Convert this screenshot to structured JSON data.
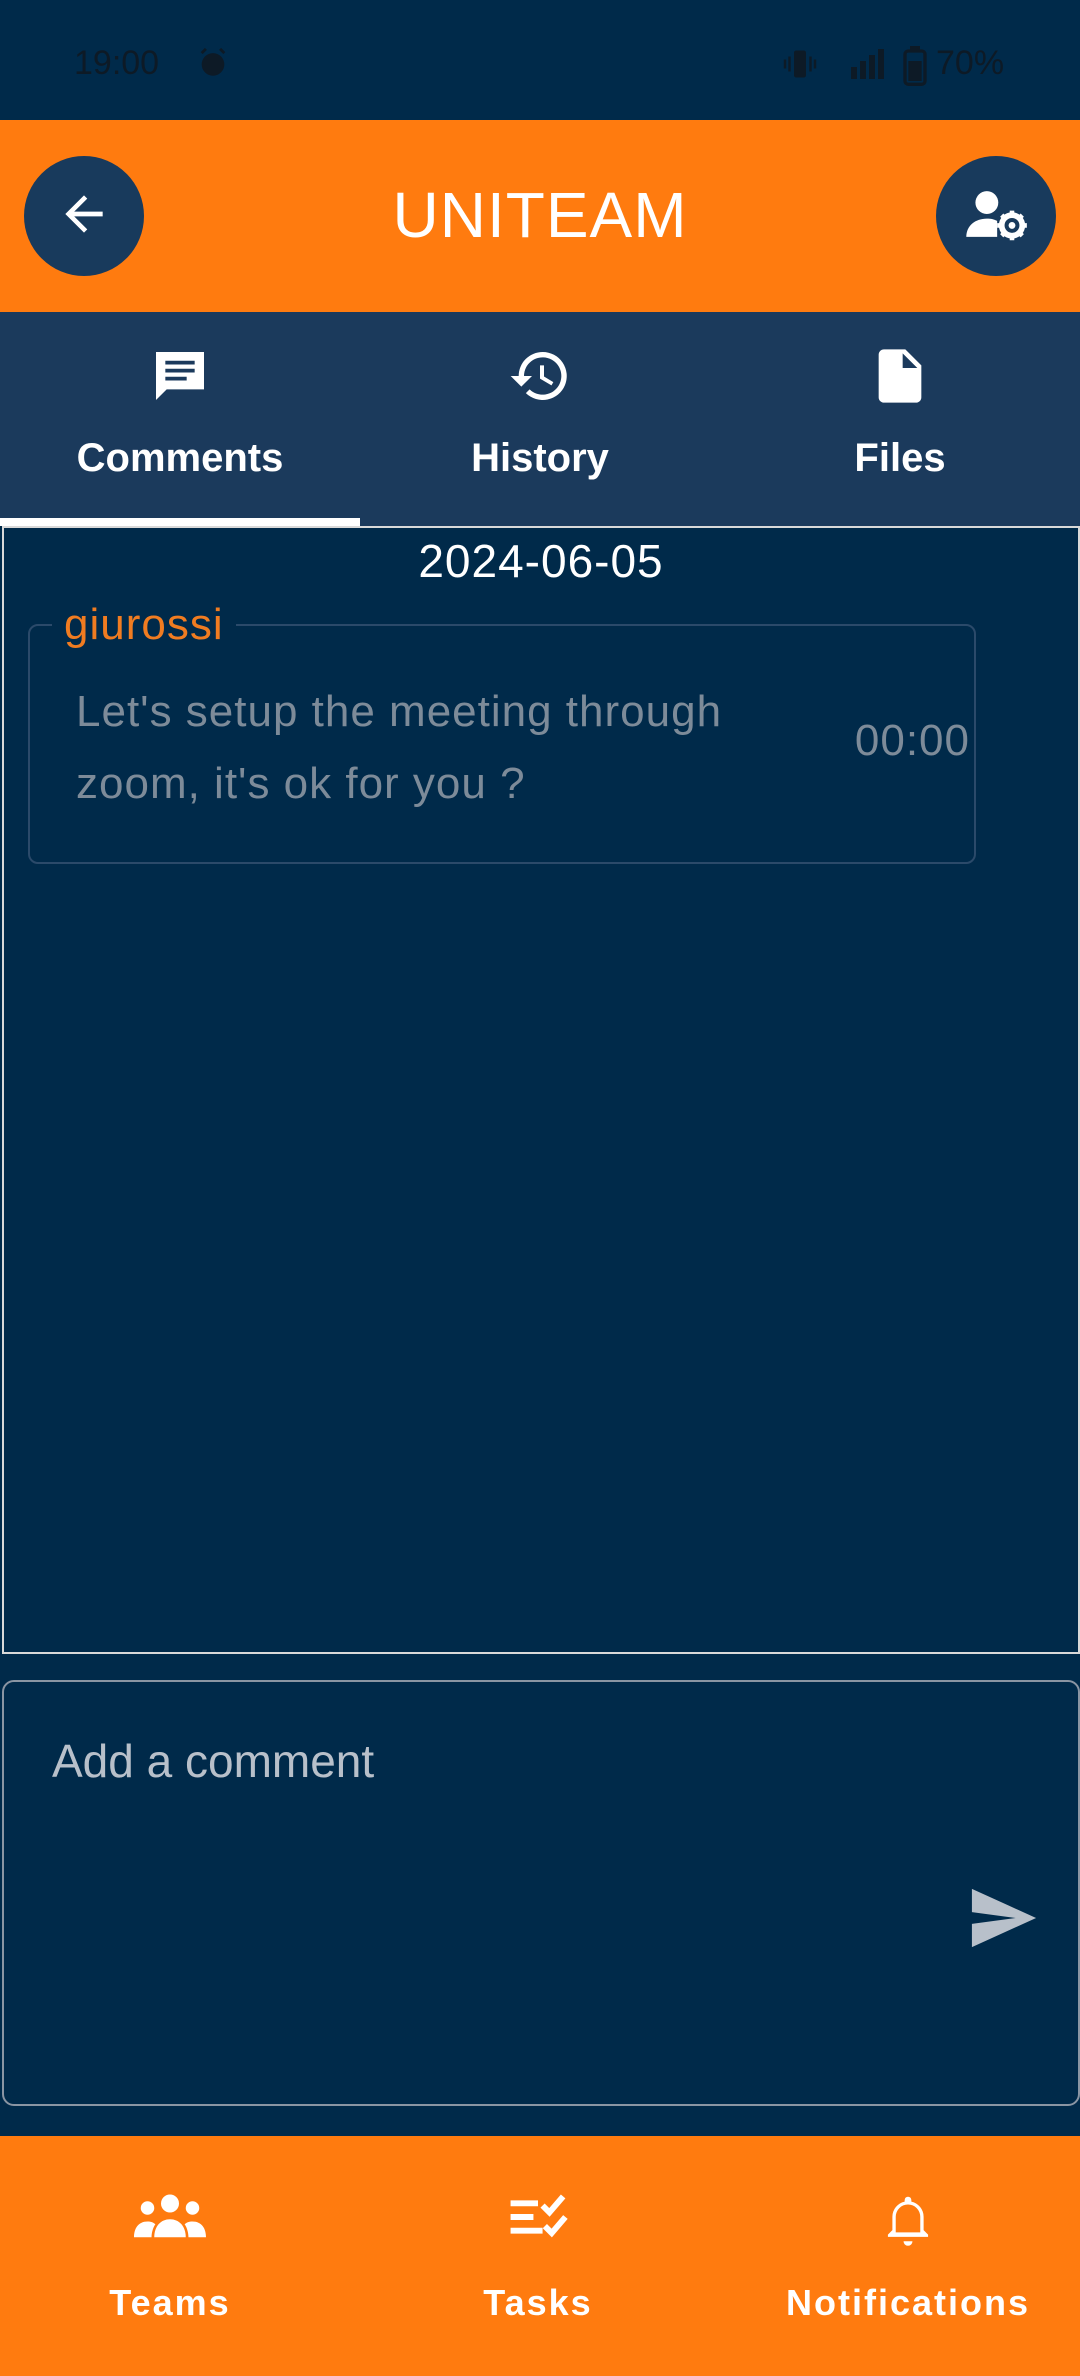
{
  "status_bar": {
    "time": "19:00",
    "battery": "70%",
    "icons": [
      "alarm-icon",
      "vibrate-icon",
      "signal-4g-icon",
      "battery-icon"
    ]
  },
  "app_bar": {
    "title": "UNITEAM",
    "back_icon": "arrow-left-icon",
    "settings_icon": "user-settings-icon"
  },
  "tabs": [
    {
      "label": "Comments",
      "icon": "comment-icon",
      "selected": true
    },
    {
      "label": "History",
      "icon": "history-icon",
      "selected": false
    },
    {
      "label": "Files",
      "icon": "file-icon",
      "selected": false
    }
  ],
  "comments": {
    "date": "2024-06-05",
    "items": [
      {
        "author": "giurossi",
        "text": "Let's setup the meeting through zoom, it's ok for you ?",
        "time": "00:00"
      }
    ]
  },
  "composer": {
    "placeholder": "Add a comment",
    "value": ""
  },
  "bottom_nav": [
    {
      "label": "Teams",
      "icon": "teams-icon"
    },
    {
      "label": "Tasks",
      "icon": "tasks-icon"
    },
    {
      "label": "Notifications",
      "icon": "bell-icon"
    }
  ],
  "colors": {
    "primary": "#ff7b0f",
    "background": "#002a4a",
    "tab_bar": "#1b3a5c",
    "author": "#f07c21"
  }
}
